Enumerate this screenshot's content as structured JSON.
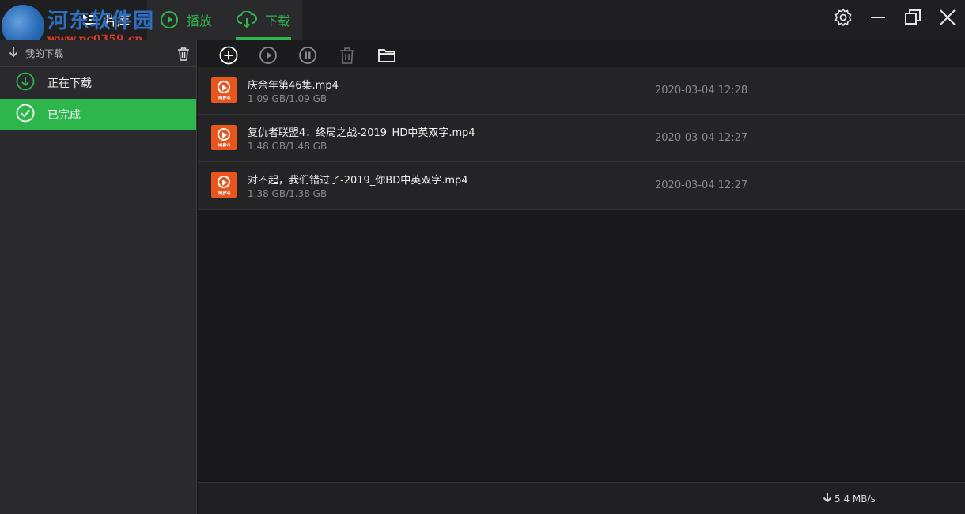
{
  "watermark": {
    "site_name": "河东软件园",
    "url": "www.pc0359.cn"
  },
  "nav": {
    "tabs": [
      {
        "label": "片库",
        "icon": "library-icon"
      },
      {
        "label": "播放",
        "icon": "play-circle-icon"
      },
      {
        "label": "下载",
        "icon": "cloud-download-icon"
      }
    ],
    "active_tab": "下载"
  },
  "window_controls": [
    "gear-icon",
    "minimize-icon",
    "restore-icon",
    "close-icon"
  ],
  "sidebar": {
    "header": "我的下载",
    "items": [
      {
        "label": "正在下载",
        "icon": "download-circle-icon"
      },
      {
        "label": "已完成",
        "icon": "check-circle-icon"
      }
    ],
    "active_item": "已完成"
  },
  "toolbar": [
    "add-icon",
    "play-icon",
    "pause-icon",
    "trash-icon",
    "folder-icon"
  ],
  "files": [
    {
      "name": "庆余年第46集.mp4",
      "size": "1.09 GB/1.09 GB",
      "date": "2020-03-04 12:28",
      "type": "MP4"
    },
    {
      "name": "复仇者联盟4：终局之战-2019_HD中英双字.mp4",
      "size": "1.48 GB/1.48 GB",
      "date": "2020-03-04 12:27",
      "type": "MP4"
    },
    {
      "name": "对不起，我们错过了-2019_你BD中英双字.mp4",
      "size": "1.38 GB/1.38 GB",
      "date": "2020-03-04 12:27",
      "type": "MP4"
    }
  ],
  "status": {
    "speed": "5.4 MB/s"
  },
  "colors": {
    "accent": "#2cb64b",
    "file_icon": "#e8561d",
    "background": "#19191b"
  }
}
